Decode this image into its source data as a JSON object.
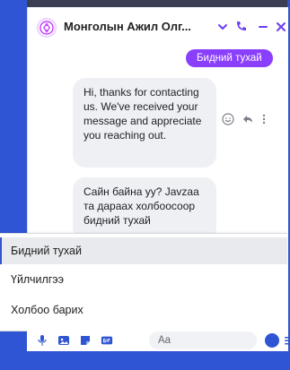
{
  "header": {
    "title": "Монголын Ажил Олг...",
    "avatar_icon": "brand-avatar-icon",
    "icons": [
      "chevron-down-icon",
      "phone-icon",
      "minimize-icon",
      "close-icon"
    ]
  },
  "messages": {
    "sent": "Бидний тухай",
    "received": [
      "Hi, thanks for contacting us. We've received your message and appreciate you reaching out.",
      "Сайн байна уу? Javzaa та дараах холбоосоор бидний тухай"
    ]
  },
  "quick_replies": [
    "Бидний тухай",
    "Үйлчилгээ",
    "Холбоо барих"
  ],
  "composer": {
    "placeholder": "Aa"
  },
  "colors": {
    "brand": "#8a3ffc",
    "accent": "#2f55d4",
    "bubble": "#eef0f3"
  }
}
